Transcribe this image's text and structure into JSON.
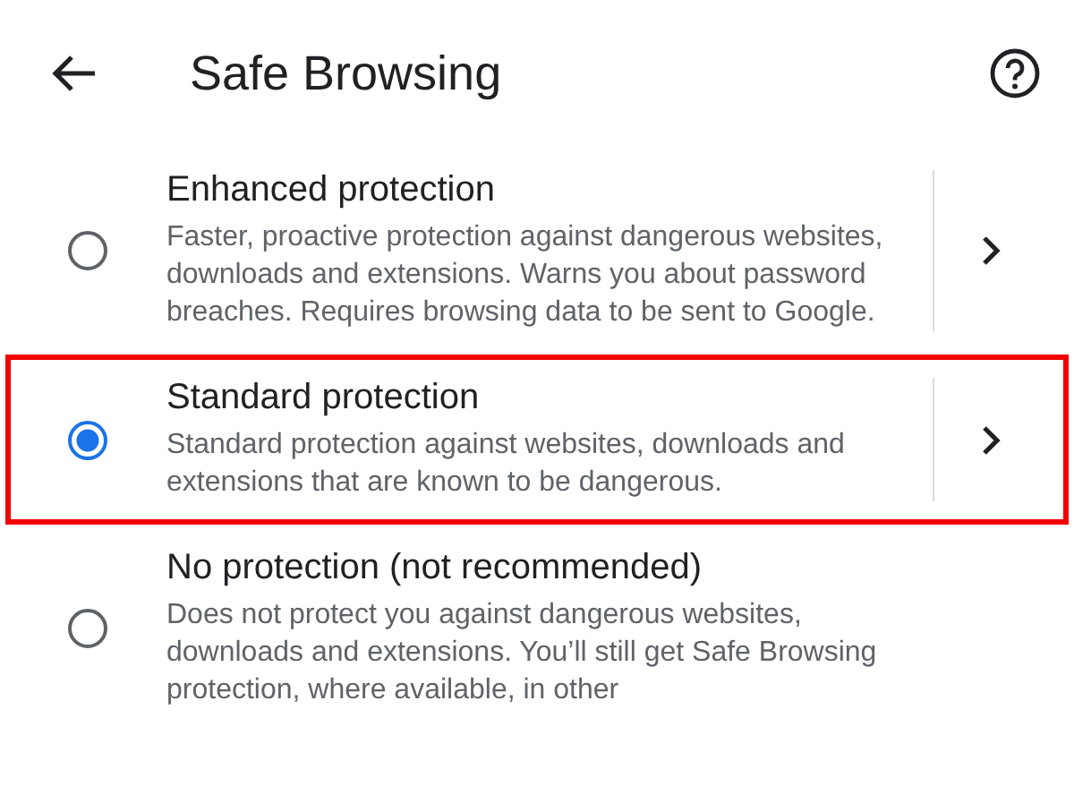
{
  "header": {
    "title": "Safe Browsing"
  },
  "options": [
    {
      "title": "Enhanced protection",
      "description": "Faster, proactive protection against dangerous websites, downloads and extensions. Warns you about password breaches. Requires browsing data to be sent to Google.",
      "selected": false,
      "highlighted": false,
      "has_details": true
    },
    {
      "title": "Standard protection",
      "description": "Standard protection against websites, downloads and extensions that are known to be dangerous.",
      "selected": true,
      "highlighted": true,
      "has_details": true
    },
    {
      "title": "No protection (not recommended)",
      "description": "Does not protect you against dangerous websites, downloads and extensions. You’ll still get Safe Browsing protection, where available, in other",
      "selected": false,
      "highlighted": false,
      "has_details": false
    }
  ]
}
